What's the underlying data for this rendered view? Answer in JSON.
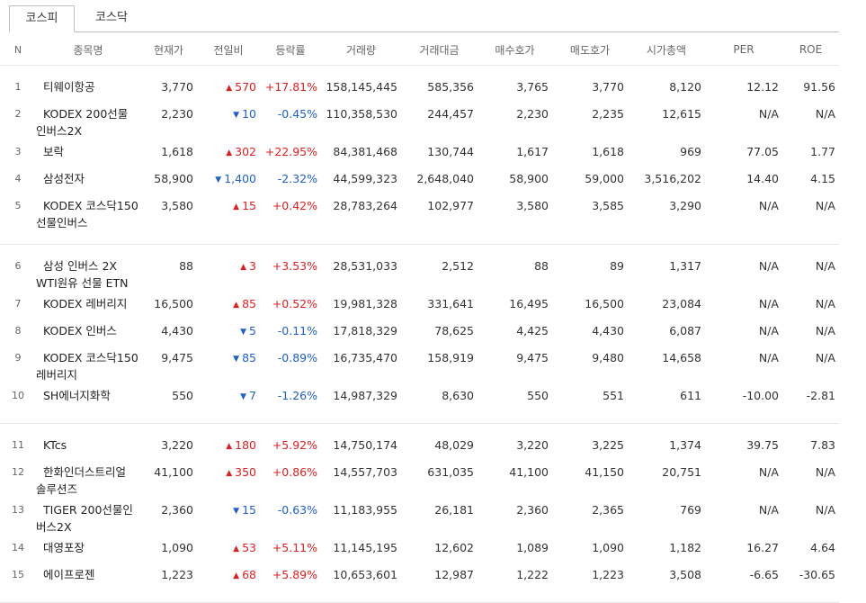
{
  "tabs": [
    {
      "label": "코스피",
      "active": true
    },
    {
      "label": "코스닥",
      "active": false
    }
  ],
  "columns": [
    "N",
    "종목명",
    "현재가",
    "전일비",
    "등락률",
    "거래량",
    "거래대금",
    "매수호가",
    "매도호가",
    "시가총액",
    "PER",
    "ROE"
  ],
  "rows": [
    {
      "n": "1",
      "name1": "티웨이항공",
      "name2": "",
      "price": "3,770",
      "dir": "up",
      "change": "570",
      "rate": "+17.81%",
      "volume": "158,145,445",
      "amount": "585,356",
      "bid": "3,765",
      "ask": "3,770",
      "cap": "8,120",
      "per": "12.12",
      "roe": "91.56"
    },
    {
      "n": "2",
      "name1": "KODEX 200선물",
      "name2": "인버스2X",
      "price": "2,230",
      "dir": "down",
      "change": "10",
      "rate": "-0.45%",
      "volume": "110,358,530",
      "amount": "244,457",
      "bid": "2,230",
      "ask": "2,235",
      "cap": "12,615",
      "per": "N/A",
      "roe": "N/A"
    },
    {
      "n": "3",
      "name1": "보락",
      "name2": "",
      "price": "1,618",
      "dir": "up",
      "change": "302",
      "rate": "+22.95%",
      "volume": "84,381,468",
      "amount": "130,744",
      "bid": "1,617",
      "ask": "1,618",
      "cap": "969",
      "per": "77.05",
      "roe": "1.77"
    },
    {
      "n": "4",
      "name1": "삼성전자",
      "name2": "",
      "price": "58,900",
      "dir": "down",
      "change": "1,400",
      "rate": "-2.32%",
      "volume": "44,599,323",
      "amount": "2,648,040",
      "bid": "58,900",
      "ask": "59,000",
      "cap": "3,516,202",
      "per": "14.40",
      "roe": "4.15"
    },
    {
      "n": "5",
      "name1": "KODEX 코스닥150",
      "name2": "선물인버스",
      "price": "3,580",
      "dir": "up",
      "change": "15",
      "rate": "+0.42%",
      "volume": "28,783,264",
      "amount": "102,977",
      "bid": "3,580",
      "ask": "3,585",
      "cap": "3,290",
      "per": "N/A",
      "roe": "N/A"
    },
    {
      "n": "6",
      "name1": "삼성 인버스 2X",
      "name2": "WTI원유 선물 ETN",
      "price": "88",
      "dir": "up",
      "change": "3",
      "rate": "+3.53%",
      "volume": "28,531,033",
      "amount": "2,512",
      "bid": "88",
      "ask": "89",
      "cap": "1,317",
      "per": "N/A",
      "roe": "N/A"
    },
    {
      "n": "7",
      "name1": "KODEX 레버리지",
      "name2": "",
      "price": "16,500",
      "dir": "up",
      "change": "85",
      "rate": "+0.52%",
      "volume": "19,981,328",
      "amount": "331,641",
      "bid": "16,495",
      "ask": "16,500",
      "cap": "23,084",
      "per": "N/A",
      "roe": "N/A"
    },
    {
      "n": "8",
      "name1": "KODEX 인버스",
      "name2": "",
      "price": "4,430",
      "dir": "down",
      "change": "5",
      "rate": "-0.11%",
      "volume": "17,818,329",
      "amount": "78,625",
      "bid": "4,425",
      "ask": "4,430",
      "cap": "6,087",
      "per": "N/A",
      "roe": "N/A"
    },
    {
      "n": "9",
      "name1": "KODEX 코스닥150",
      "name2": "레버리지",
      "price": "9,475",
      "dir": "down",
      "change": "85",
      "rate": "-0.89%",
      "volume": "16,735,470",
      "amount": "158,919",
      "bid": "9,475",
      "ask": "9,480",
      "cap": "14,658",
      "per": "N/A",
      "roe": "N/A"
    },
    {
      "n": "10",
      "name1": "SH에너지화학",
      "name2": "",
      "price": "550",
      "dir": "down",
      "change": "7",
      "rate": "-1.26%",
      "volume": "14,987,329",
      "amount": "8,630",
      "bid": "550",
      "ask": "551",
      "cap": "611",
      "per": "-10.00",
      "roe": "-2.81"
    },
    {
      "n": "11",
      "name1": "KTcs",
      "name2": "",
      "price": "3,220",
      "dir": "up",
      "change": "180",
      "rate": "+5.92%",
      "volume": "14,750,174",
      "amount": "48,029",
      "bid": "3,220",
      "ask": "3,225",
      "cap": "1,374",
      "per": "39.75",
      "roe": "7.83"
    },
    {
      "n": "12",
      "name1": "한화인더스트리얼",
      "name2": "솔루션즈",
      "price": "41,100",
      "dir": "up",
      "change": "350",
      "rate": "+0.86%",
      "volume": "14,557,703",
      "amount": "631,035",
      "bid": "41,100",
      "ask": "41,150",
      "cap": "20,751",
      "per": "N/A",
      "roe": "N/A"
    },
    {
      "n": "13",
      "name1": "TIGER 200선물인",
      "name2": "버스2X",
      "price": "2,360",
      "dir": "down",
      "change": "15",
      "rate": "-0.63%",
      "volume": "11,183,955",
      "amount": "26,181",
      "bid": "2,360",
      "ask": "2,365",
      "cap": "769",
      "per": "N/A",
      "roe": "N/A"
    },
    {
      "n": "14",
      "name1": "대영포장",
      "name2": "",
      "price": "1,090",
      "dir": "up",
      "change": "53",
      "rate": "+5.11%",
      "volume": "11,145,195",
      "amount": "12,602",
      "bid": "1,089",
      "ask": "1,090",
      "cap": "1,182",
      "per": "16.27",
      "roe": "4.64"
    },
    {
      "n": "15",
      "name1": "에이프로젠",
      "name2": "",
      "price": "1,223",
      "dir": "up",
      "change": "68",
      "rate": "+5.89%",
      "volume": "10,653,601",
      "amount": "12,987",
      "bid": "1,222",
      "ask": "1,223",
      "cap": "3,508",
      "per": "-6.65",
      "roe": "-30.65"
    }
  ],
  "icons": {
    "up": "triangle-up-icon",
    "down": "triangle-down-icon"
  },
  "colors": {
    "up": "#e02020",
    "down": "#1f5fc9"
  }
}
